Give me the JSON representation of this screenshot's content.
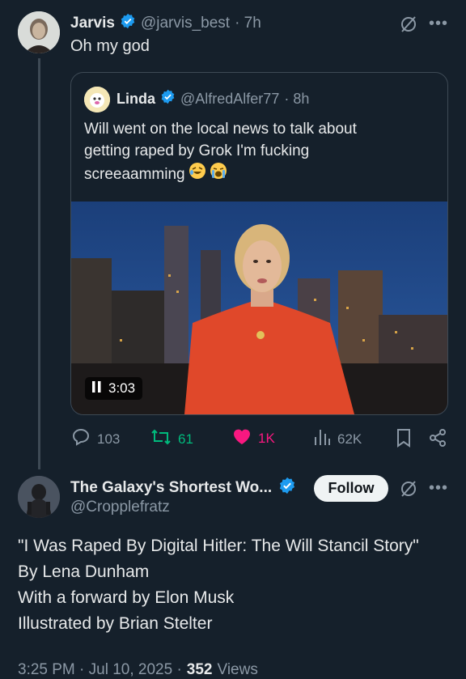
{
  "tweet": {
    "author_name": "Jarvis",
    "author_handle": "@jarvis_best",
    "time": "· 7h",
    "text": "Oh my god"
  },
  "quoted": {
    "author_name": "Linda",
    "author_handle": "@AlfredAlfer77",
    "time": "· 8h",
    "text_line1": "Will went on the local news to talk about",
    "text_line2": "getting raped by Grok I'm fucking",
    "text_line3": "screeaamming",
    "video_duration": "3:03"
  },
  "actions": {
    "replies": "103",
    "retweets": "61",
    "likes": "1K",
    "views": "62K"
  },
  "reply": {
    "author_name": "The Galaxy's Shortest Wo...",
    "author_handle": "@Cropplefratz",
    "follow_label": "Follow",
    "lines": [
      "\"I Was Raped By Digital Hitler: The Will Stancil Story\"",
      "By Lena Dunham",
      "With a forward by Elon Musk",
      "Illustrated by Brian Stelter"
    ],
    "timestamp": "3:25 PM · Jul 10, 2025 ·",
    "views_count": "352",
    "views_label": "Views"
  },
  "colors": {
    "background": "#15202b",
    "verified": "#1d9bf0",
    "like": "#f91880",
    "retweet": "#00ba7c",
    "muted": "#8b98a5"
  }
}
